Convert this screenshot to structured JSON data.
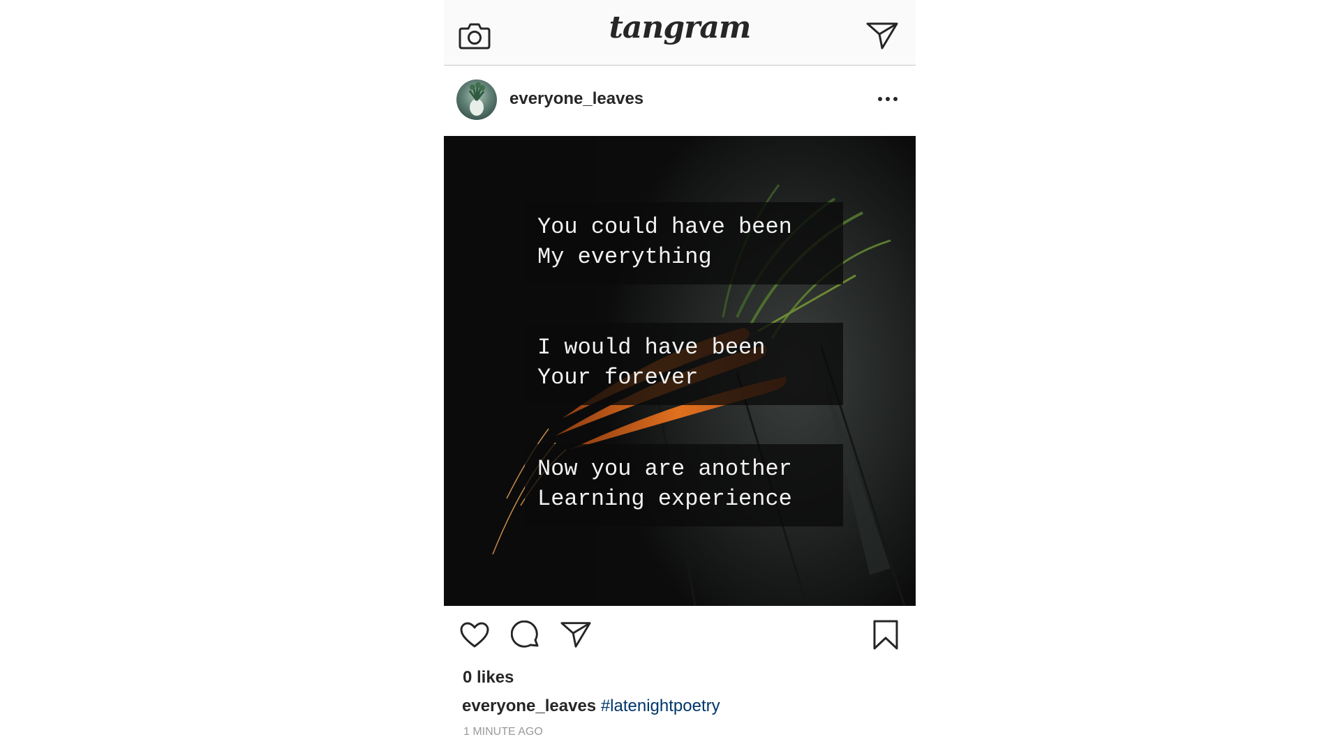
{
  "app": {
    "logo_text": "tangram"
  },
  "topbar": {
    "camera_icon": "camera-icon",
    "send_icon": "paper-plane-icon"
  },
  "post": {
    "username": "everyone_leaves",
    "more_icon": "more-options-icon",
    "image_text": [
      "You could have been\nMy everything",
      "I would have been\nYour forever",
      "Now you are another\nLearning experience"
    ],
    "likes": "0 likes",
    "caption_user": "everyone_leaves",
    "caption_hashtag": "#latenightpoetry",
    "timestamp": "1 MINUTE AGO"
  },
  "actions": {
    "like_icon": "heart-icon",
    "comment_icon": "comment-bubble-icon",
    "share_icon": "paper-plane-icon",
    "save_icon": "bookmark-icon"
  },
  "colors": {
    "text": "#262626",
    "hashtag": "#003569",
    "muted": "#999999",
    "topbar_bg": "#fafafa"
  }
}
